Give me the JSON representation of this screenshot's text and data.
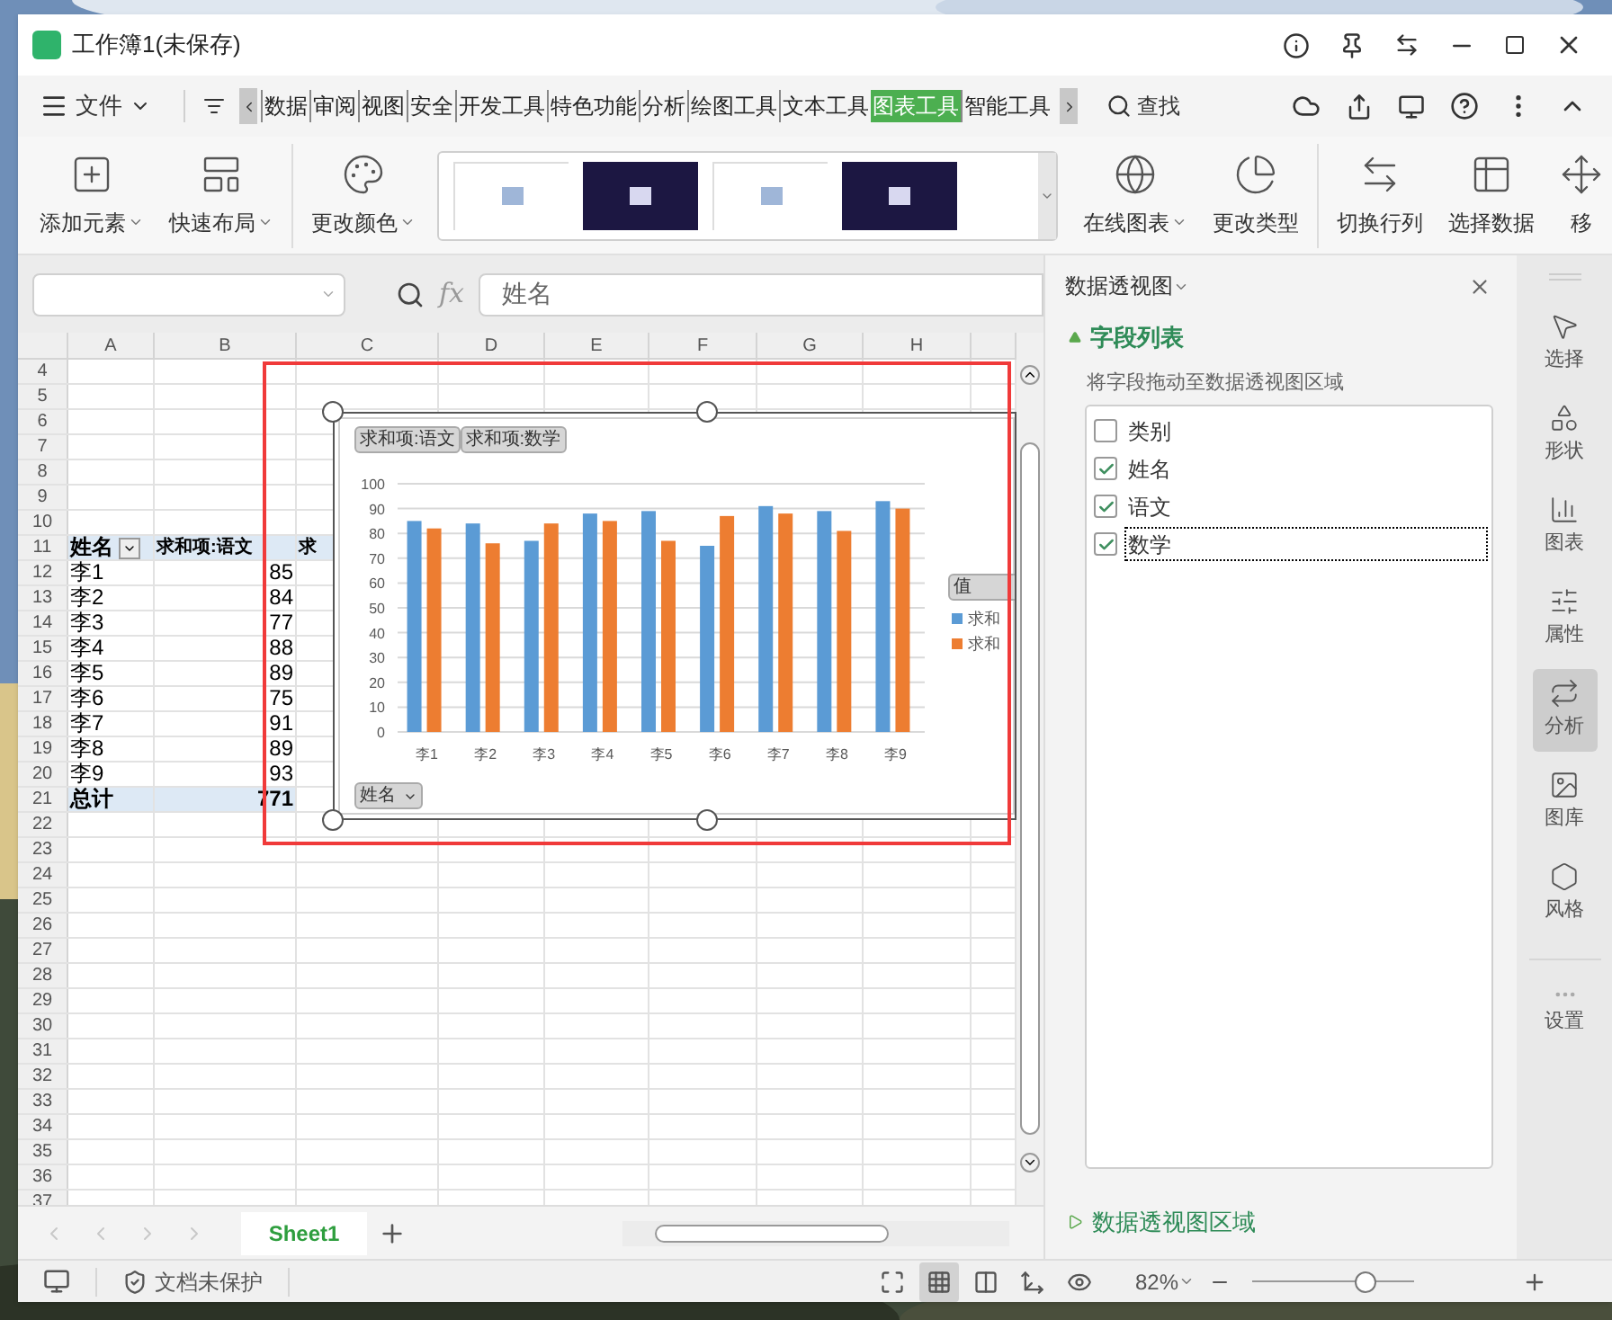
{
  "window": {
    "title": "工作簿1(未保存)"
  },
  "menu": {
    "file": "文件",
    "search": "查找",
    "tabs": [
      {
        "label": "数据",
        "selected": false
      },
      {
        "label": "审阅",
        "selected": false
      },
      {
        "label": "视图",
        "selected": false
      },
      {
        "label": "安全",
        "selected": false
      },
      {
        "label": "开发工具",
        "selected": false
      },
      {
        "label": "特色功能",
        "selected": false
      },
      {
        "label": "分析",
        "selected": false
      },
      {
        "label": "绘图工具",
        "selected": false
      },
      {
        "label": "文本工具",
        "selected": false
      },
      {
        "label": "图表工具",
        "selected": true
      },
      {
        "label": "智能工具",
        "selected": false
      }
    ]
  },
  "ribbon": [
    {
      "kind": "button",
      "label": "添加元素",
      "dropdown": true
    },
    {
      "kind": "button",
      "label": "快速布局",
      "dropdown": true
    },
    {
      "kind": "button",
      "label": "更改颜色",
      "dropdown": true
    },
    {
      "kind": "gallery",
      "thumbnails": [
        {
          "dark": false
        },
        {
          "dark": true
        },
        {
          "dark": false
        },
        {
          "dark": true
        }
      ]
    },
    {
      "kind": "button",
      "label": "在线图表",
      "dropdown": true
    },
    {
      "kind": "button",
      "label": "更改类型",
      "dropdown": false
    },
    {
      "kind": "button",
      "label": "切换行列",
      "dropdown": false
    },
    {
      "kind": "button",
      "label": "选择数据",
      "dropdown": false
    },
    {
      "kind": "button",
      "label": "移",
      "dropdown": false
    }
  ],
  "formula_bar": {
    "fx_label": "fx",
    "value": "姓名"
  },
  "sheet": {
    "columns": [
      "A",
      "B",
      "C",
      "D",
      "E",
      "F",
      "G",
      "H"
    ],
    "rows": [
      {
        "number": "4"
      },
      {
        "number": "5"
      },
      {
        "number": "6"
      },
      {
        "number": "7"
      },
      {
        "number": "8"
      },
      {
        "number": "9"
      },
      {
        "number": "10"
      },
      {
        "number": "11",
        "kind": "header",
        "cells": [
          "姓名",
          "求和项:语文",
          "求"
        ]
      },
      {
        "number": "12",
        "kind": "data",
        "cells": [
          "李1",
          "85"
        ]
      },
      {
        "number": "13",
        "kind": "data",
        "cells": [
          "李2",
          "84"
        ]
      },
      {
        "number": "14",
        "kind": "data",
        "cells": [
          "李3",
          "77"
        ]
      },
      {
        "number": "15",
        "kind": "data",
        "cells": [
          "李4",
          "88"
        ]
      },
      {
        "number": "16",
        "kind": "data",
        "cells": [
          "李5",
          "89"
        ]
      },
      {
        "number": "17",
        "kind": "data",
        "cells": [
          "李6",
          "75"
        ]
      },
      {
        "number": "18",
        "kind": "data",
        "cells": [
          "李7",
          "91"
        ]
      },
      {
        "number": "19",
        "kind": "data",
        "cells": [
          "李8",
          "89"
        ]
      },
      {
        "number": "20",
        "kind": "data",
        "cells": [
          "李9",
          "93"
        ]
      },
      {
        "number": "21",
        "kind": "total",
        "cells": [
          "总计",
          "771"
        ]
      },
      {
        "number": "22"
      },
      {
        "number": "23"
      },
      {
        "number": "24"
      },
      {
        "number": "25"
      },
      {
        "number": "26"
      },
      {
        "number": "27"
      },
      {
        "number": "28"
      },
      {
        "number": "29"
      },
      {
        "number": "30"
      },
      {
        "number": "31"
      },
      {
        "number": "32"
      },
      {
        "number": "33"
      },
      {
        "number": "34"
      },
      {
        "number": "35"
      },
      {
        "number": "36"
      },
      {
        "number": "37"
      }
    ]
  },
  "chart": {
    "axis_button": "姓名",
    "legend_button": "值",
    "legend": [
      {
        "label": "求和",
        "color": "#5b9bd5"
      },
      {
        "label": "求和",
        "color": "#ed7d31"
      }
    ],
    "chart_data": {
      "type": "bar",
      "categories": [
        "李1",
        "李2",
        "李3",
        "李4",
        "李5",
        "李6",
        "李7",
        "李8",
        "李9"
      ],
      "series": [
        {
          "name": "求和项:语文",
          "color": "#5b9bd5",
          "values": [
            85,
            84,
            77,
            88,
            89,
            75,
            91,
            89,
            93
          ]
        },
        {
          "name": "求和项:数学",
          "color": "#ed7d31",
          "values": [
            82,
            76,
            84,
            85,
            77,
            87,
            88,
            81,
            90
          ]
        }
      ],
      "ylim": [
        0,
        100
      ],
      "yticks": [
        0,
        10,
        20,
        30,
        40,
        50,
        60,
        70,
        80,
        90,
        100
      ],
      "grid": true
    }
  },
  "sheet_tabs": [
    {
      "label": "Sheet1",
      "selected": true
    }
  ],
  "panel": {
    "title": "数据透视图",
    "section": "字段列表",
    "hint": "将字段拖动至数据透视图区域",
    "fields": [
      {
        "label": "类别",
        "checked": false,
        "focused": false
      },
      {
        "label": "姓名",
        "checked": true,
        "focused": false
      },
      {
        "label": "语文",
        "checked": true,
        "focused": false
      },
      {
        "label": "数学",
        "checked": true,
        "focused": true
      }
    ],
    "footer_section": "数据透视图区域"
  },
  "sidebar": {
    "items": [
      {
        "label": "选择",
        "selected": false
      },
      {
        "label": "形状",
        "selected": false
      },
      {
        "label": "图表",
        "selected": false
      },
      {
        "label": "属性",
        "selected": false
      },
      {
        "label": "分析",
        "selected": true
      },
      {
        "label": "图库",
        "selected": false
      },
      {
        "label": "风格",
        "selected": false
      }
    ],
    "settings": "设置"
  },
  "status_bar": {
    "protection": "文档未保护",
    "view_modes": [
      {
        "selected": false
      },
      {
        "selected": true
      },
      {
        "selected": false
      },
      {
        "selected": false
      },
      {
        "selected": false
      }
    ],
    "zoom": {
      "label": "82%",
      "level": 0.7
    }
  }
}
